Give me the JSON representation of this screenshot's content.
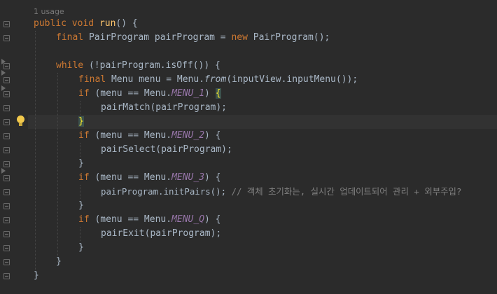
{
  "editor": {
    "usage_hint": "1 usage",
    "lines": {
      "l1": {
        "kw": "public",
        "kw2": "void",
        "name": "run",
        "rest": "() {"
      },
      "l2": {
        "kw": "final",
        "type": "PairProgram",
        "var": "pairProgram",
        "eq": " = ",
        "kw2": "new",
        "ctor": "PairProgram",
        "rest": "();"
      },
      "l4": {
        "kw": "while",
        "rest1": " (!pairProgram.isOff()) {"
      },
      "l5": {
        "kw": "final",
        "type": "Menu",
        "var": " menu = Menu.",
        "method": "from",
        "rest": "(inputView.inputMenu());"
      },
      "l6": {
        "kw": "if",
        "pre": " (menu == Menu.",
        "const": "MENU_1",
        "post": ") ",
        "brace": "{"
      },
      "l7": {
        "text": "pairMatch(pairProgram);"
      },
      "l8": {
        "brace": "}"
      },
      "l9": {
        "kw": "if",
        "pre": " (menu == Menu.",
        "const": "MENU_2",
        "post": ") {"
      },
      "l10": {
        "text": "pairSelect(pairProgram);"
      },
      "l11": {
        "brace": "}"
      },
      "l12": {
        "kw": "if",
        "pre": " (menu == Menu.",
        "const": "MENU_3",
        "post": ") {"
      },
      "l13": {
        "text": "pairProgram.initPairs(); ",
        "comment": "// 객체 초기화는, 실시간 업데이트되어 관리 + 외부주입?"
      },
      "l14": {
        "brace": "}"
      },
      "l15": {
        "kw": "if",
        "pre": " (menu == Menu.",
        "const": "MENU_Q",
        "post": ") {"
      },
      "l16": {
        "text": "pairExit(pairProgram);"
      },
      "l17": {
        "brace": "}"
      },
      "l18": {
        "brace": "}"
      },
      "l19": {
        "brace": "}"
      }
    },
    "icons": [
      "fold-icon",
      "lightbulb-icon",
      "breakpoint-arrow-icon"
    ]
  }
}
